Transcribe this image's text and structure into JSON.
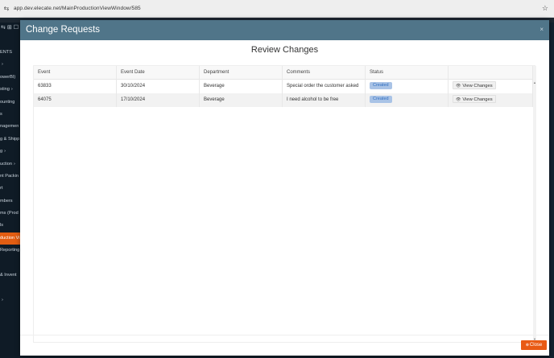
{
  "browser": {
    "url": "app.dev.elecate.net/MainProductionViewWindow/585",
    "star_icon": "star-icon"
  },
  "sidebar": {
    "top_icons": [
      "⇆",
      "⊞",
      "☐"
    ],
    "items": [
      {
        "label": "ENTS",
        "chevron": ""
      },
      {
        "label": "",
        "chevron": "›"
      },
      {
        "label": "owerBI)",
        "chevron": ""
      },
      {
        "label": "sting",
        "chevron": "›"
      },
      {
        "label": "ounting",
        "chevron": ""
      },
      {
        "label": "s",
        "chevron": ""
      },
      {
        "label": "nagemen",
        "chevron": ""
      },
      {
        "label": "g & Shipp",
        "chevron": ""
      },
      {
        "label": "g",
        "chevron": "›"
      },
      {
        "label": "uction",
        "chevron": "›"
      },
      {
        "label": "nt Packin",
        "chevron": ""
      },
      {
        "label": "rt",
        "chevron": ""
      },
      {
        "label": "mbers",
        "chevron": ""
      },
      {
        "label": "ms (Prod",
        "chevron": ""
      },
      {
        "label": "ls",
        "chevron": ""
      },
      {
        "label": "duction Vi",
        "chevron": "",
        "active": true
      },
      {
        "label": "Reporting",
        "chevron": ""
      },
      {
        "label": "",
        "chevron": ""
      },
      {
        "label": "& Invent",
        "chevron": ""
      },
      {
        "label": "",
        "chevron": ""
      },
      {
        "label": "",
        "chevron": "›"
      }
    ]
  },
  "modal": {
    "title": "Change Requests",
    "close_x": "×",
    "subtitle": "Review Changes",
    "close_button": "Close"
  },
  "table": {
    "columns": [
      "Event",
      "Event Date",
      "Department",
      "Comments",
      "Status",
      ""
    ],
    "rows": [
      {
        "event": "63833",
        "date": "30/10/2024",
        "department": "Beverage",
        "comments": "Special order the customer asked",
        "status": "Created",
        "action": "View Changes"
      },
      {
        "event": "64075",
        "date": "17/10/2024",
        "department": "Beverage",
        "comments": "I need alcohol to be free",
        "status": "Created",
        "action": "View Changes"
      }
    ]
  },
  "colors": {
    "header": "#507589",
    "accent": "#e95a14",
    "badge_bg": "#a9c3e6",
    "badge_text": "#2f6dbf"
  }
}
